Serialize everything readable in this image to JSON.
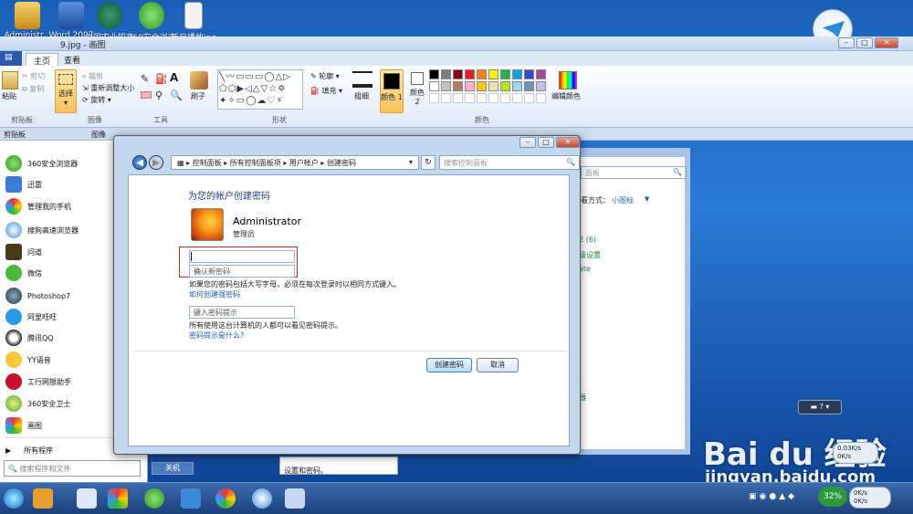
{
  "desktop": {
    "icons": [
      {
        "label": "Administr..."
      },
      {
        "label": "Word 2007"
      },
      {
        "label": "中国农业银行"
      },
      {
        "label": "360安全浏览"
      },
      {
        "label": "新目播放jpg"
      }
    ]
  },
  "paint": {
    "title": "9.jpg - 画图",
    "tabs": [
      "主页",
      "查看"
    ],
    "clipboard": {
      "paste": "粘贴",
      "cut": "剪切",
      "copy": "复制",
      "label": "剪贴板"
    },
    "image": {
      "select": "选择",
      "crop": "裁剪",
      "resize": "重新调整大小",
      "rotate": "旋转",
      "label": "图像"
    },
    "tools_label": "工具",
    "brush_label": "刷子",
    "shapes": {
      "outline": "轮廓",
      "fill": "填充",
      "label": "形状"
    },
    "size_label": "粗细",
    "color1": "颜色 1",
    "color2": "颜色 2",
    "colors_label": "颜色",
    "edit_colors": "编辑颜色",
    "band_left": "剪贴板",
    "band_mid": "图像"
  },
  "start_menu": {
    "items": [
      {
        "label": "360安全浏览器"
      },
      {
        "label": "迅雷"
      },
      {
        "label": "管理我的手机"
      },
      {
        "label": "搜狗高速浏览器"
      },
      {
        "label": "问道"
      },
      {
        "label": "微信"
      },
      {
        "label": "Photoshop7"
      },
      {
        "label": "阿里旺旺"
      },
      {
        "label": "腾讯QQ"
      },
      {
        "label": "YY语音"
      },
      {
        "label": "工行网银助手"
      },
      {
        "label": "360安全卫士"
      },
      {
        "label": "画图"
      }
    ],
    "all_programs": "所有程序",
    "search_placeholder": "搜索程序和文件",
    "shutdown": "关机"
  },
  "bg_window": {
    "search": "面板",
    "view_by": "查看方式：",
    "view_value": "小图标",
    "link1": "2 (6)",
    "link2": "级设置",
    "link3": "ate",
    "link4": "器",
    "tooltip": "设置和密码。"
  },
  "dialog": {
    "breadcrumb": [
      "控制面板",
      "所有控制面板项",
      "用户帐户",
      "创建密码"
    ],
    "search_placeholder": "搜索控制面板",
    "heading": "为您的帐户创建密码",
    "account_name": "Administrator",
    "account_role": "管理员",
    "new_password_value": "",
    "confirm_placeholder": "确认新密码",
    "case_note": "如果您的密码包括大写字母，必须在每次登录时以相同方式键入。",
    "strong_link": "如何创建强密码",
    "hint_placeholder": "键入密码提示",
    "hint_note": "所有使用这台计算机的人都可以看见密码提示。",
    "hint_link": "密码提示是什么?",
    "create_button": "创建密码",
    "cancel_button": "取消"
  },
  "taskbar": {
    "net_percent": "32%",
    "speed_up": "0.03K/s",
    "speed_down": "0K/s",
    "speed_up2": "0K/s",
    "speed_down2": "0K/s"
  },
  "watermark": {
    "logo": "Bai du 经验",
    "url": "jingyan.baidu.com"
  },
  "palette": [
    "#000000",
    "#7f7f7f",
    "#880015",
    "#ed1c24",
    "#ff7f27",
    "#fff200",
    "#22b14c",
    "#00a2e8",
    "#3f48cc",
    "#a349a4",
    "#ffffff",
    "#c3c3c3",
    "#b97a57",
    "#ffaec9",
    "#ffc90e",
    "#efe4b0",
    "#b5e61d",
    "#99d9ea",
    "#7092be",
    "#c8bfe7"
  ]
}
